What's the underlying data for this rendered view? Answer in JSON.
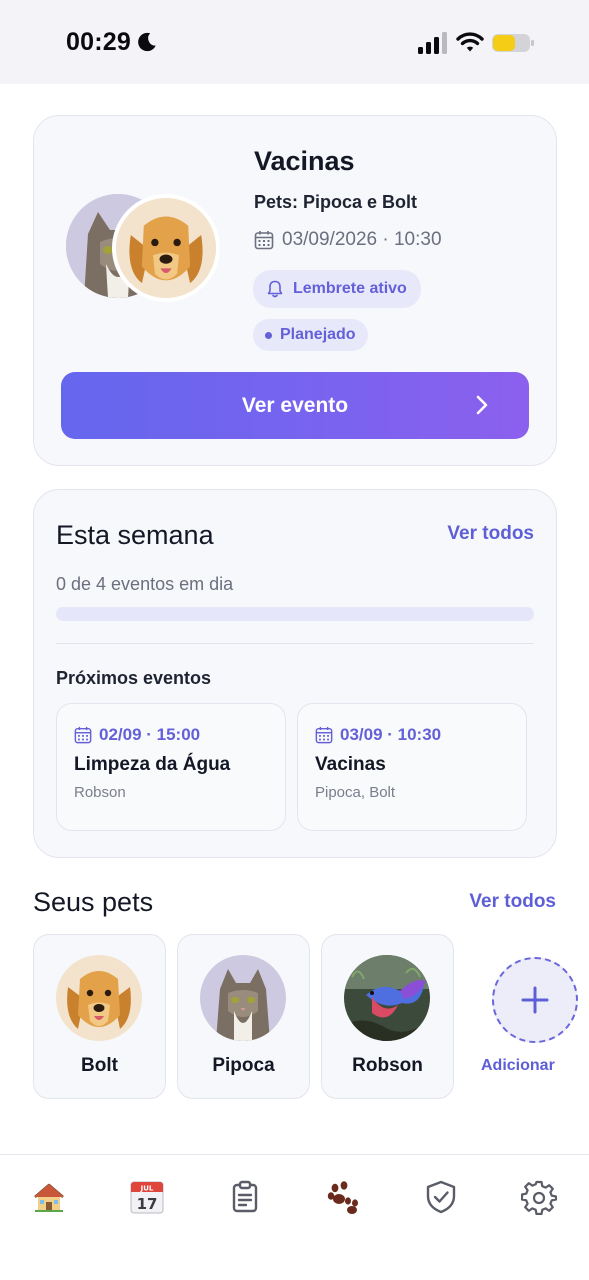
{
  "status_bar": {
    "time": "00:29",
    "icons": [
      "moon-icon",
      "cellular-signal-icon",
      "wifi-icon",
      "battery-icon"
    ]
  },
  "hero": {
    "title": "Vacinas",
    "pets": "Pets: Pipoca e Bolt",
    "datetime": "03/09/2026 · 10:30",
    "reminder": "Lembrete ativo",
    "status": "Planejado",
    "button": "Ver evento",
    "avatars": [
      "cat-photo",
      "dog-photo"
    ]
  },
  "week": {
    "title": "Esta semana",
    "link": "Ver todos",
    "progress_text": "0 de 4 eventos em dia",
    "progress": 0,
    "upcoming_title": "Próximos eventos",
    "events": [
      {
        "date": "02/09 · 15:00",
        "title": "Limpeza da Água",
        "pets": "Robson"
      },
      {
        "date": "03/09 · 10:30",
        "title": "Vacinas",
        "pets": "Pipoca, Bolt"
      }
    ]
  },
  "pets": {
    "title": "Seus pets",
    "link": "Ver todos",
    "items": [
      {
        "name": "Bolt",
        "photo": "dog-photo"
      },
      {
        "name": "Pipoca",
        "photo": "cat-photo"
      },
      {
        "name": "Robson",
        "photo": "fish-photo"
      }
    ],
    "add_label": "Adicionar"
  },
  "nav": {
    "items": [
      "home-icon",
      "calendar-icon",
      "clipboard-icon",
      "paw-icon",
      "shield-check-icon",
      "gear-icon"
    ],
    "calendar_month": "JUL",
    "calendar_day": "17"
  },
  "colors": {
    "accent": "#6566ee",
    "accent_text": "#5e5fd6",
    "pill_bg": "#e8e8fb",
    "card_bg": "#f7f8fb"
  }
}
